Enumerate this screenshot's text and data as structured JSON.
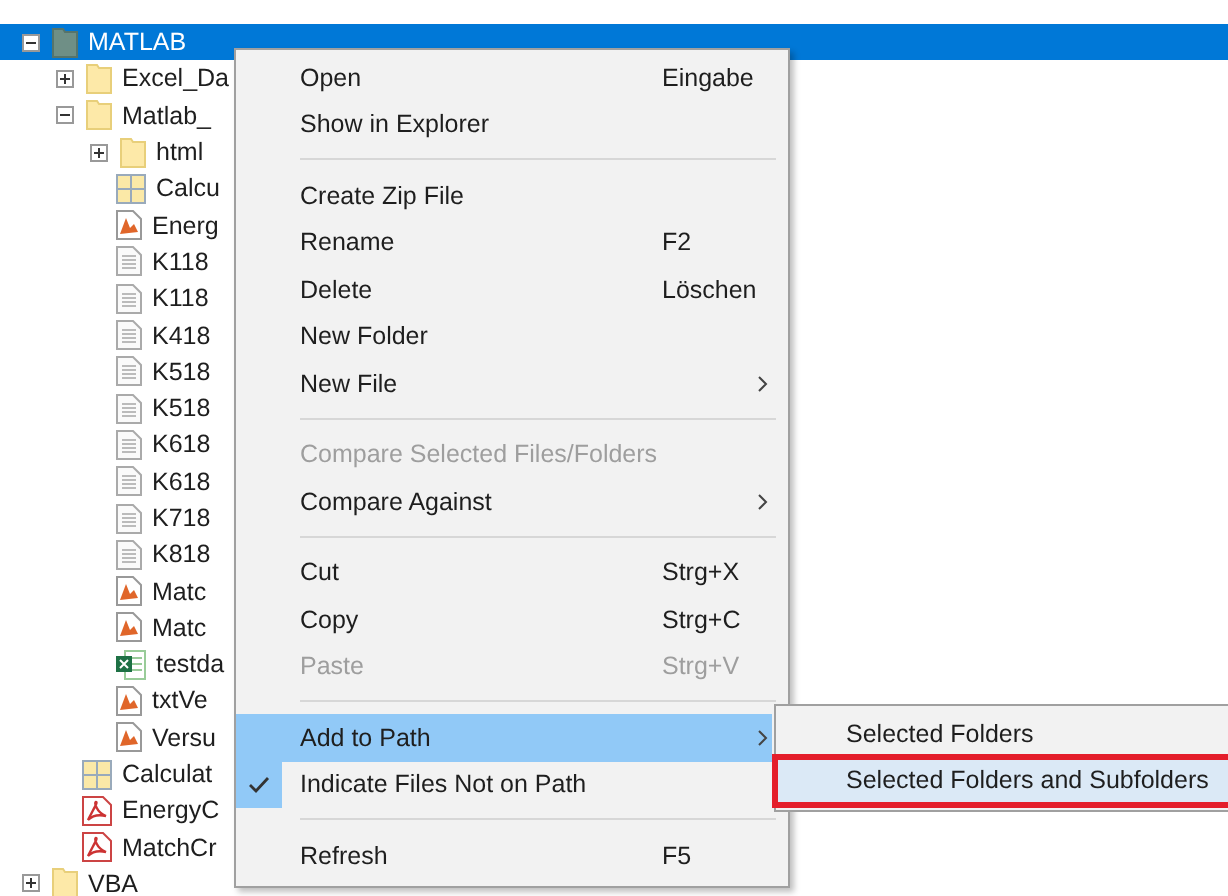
{
  "tree": [
    {
      "label": "MATLAB",
      "kind": "project",
      "expanded": true,
      "selected": true,
      "children": [
        {
          "label": "Excel_Da",
          "kind": "folder",
          "expanded": false,
          "selected": false
        },
        {
          "label": "Matlab_",
          "kind": "folder",
          "expanded": true,
          "selected": false,
          "children": [
            {
              "label": "html",
              "kind": "folder",
              "expanded": false,
              "selected": false
            },
            {
              "label": "Calcu",
              "kind": "app",
              "selected": false
            },
            {
              "label": "Energ",
              "kind": "script",
              "selected": false
            },
            {
              "label": "K118",
              "kind": "text",
              "selected": false
            },
            {
              "label": "K118",
              "kind": "text",
              "selected": false
            },
            {
              "label": "K418",
              "kind": "text",
              "selected": false
            },
            {
              "label": "K518",
              "kind": "text",
              "selected": false
            },
            {
              "label": "K518",
              "kind": "text",
              "selected": false
            },
            {
              "label": "K618",
              "kind": "text",
              "selected": false
            },
            {
              "label": "K618",
              "kind": "text",
              "selected": false
            },
            {
              "label": "K718",
              "kind": "text",
              "selected": false
            },
            {
              "label": "K818",
              "kind": "text",
              "selected": false
            },
            {
              "label": "Matc",
              "kind": "script",
              "selected": false
            },
            {
              "label": "Matc",
              "kind": "script",
              "selected": false
            },
            {
              "label": "testda",
              "kind": "excel",
              "selected": false
            },
            {
              "label": "txtVe",
              "kind": "script",
              "selected": false
            },
            {
              "label": "Versu",
              "kind": "script",
              "selected": false
            }
          ]
        },
        {
          "label": "Calculat",
          "kind": "app",
          "selected": false
        },
        {
          "label": "EnergyC",
          "kind": "pdf",
          "selected": false
        },
        {
          "label": "MatchCr",
          "kind": "pdf",
          "selected": false
        }
      ]
    },
    {
      "label": "VBA",
      "kind": "folder",
      "expanded": false,
      "selected": false
    }
  ],
  "context_menu": [
    {
      "kind": "item",
      "label": "Open",
      "shortcut": "Eingabe",
      "disabled": false,
      "checked": false,
      "selected": false,
      "submenu": false
    },
    {
      "kind": "item",
      "label": "Show in Explorer",
      "disabled": false,
      "checked": false,
      "selected": false,
      "submenu": false
    },
    {
      "kind": "separator"
    },
    {
      "kind": "item",
      "label": "Create Zip File",
      "disabled": false,
      "checked": false,
      "selected": false,
      "submenu": false
    },
    {
      "kind": "item",
      "label": "Rename",
      "shortcut": "F2",
      "disabled": false,
      "checked": false,
      "selected": false,
      "submenu": false
    },
    {
      "kind": "item",
      "label": "Delete",
      "shortcut": "Löschen",
      "disabled": false,
      "checked": false,
      "selected": false,
      "submenu": false
    },
    {
      "kind": "item",
      "label": "New Folder",
      "disabled": false,
      "checked": false,
      "selected": false,
      "submenu": false
    },
    {
      "kind": "item",
      "label": "New File",
      "disabled": false,
      "checked": false,
      "selected": false,
      "submenu": true
    },
    {
      "kind": "separator"
    },
    {
      "kind": "item",
      "label": "Compare Selected Files/Folders",
      "disabled": true,
      "checked": false,
      "selected": false,
      "submenu": false
    },
    {
      "kind": "item",
      "label": "Compare Against",
      "disabled": false,
      "checked": false,
      "selected": false,
      "submenu": true
    },
    {
      "kind": "separator"
    },
    {
      "kind": "item",
      "label": "Cut",
      "shortcut": "Strg+X",
      "disabled": false,
      "checked": false,
      "selected": false,
      "submenu": false
    },
    {
      "kind": "item",
      "label": "Copy",
      "shortcut": "Strg+C",
      "disabled": false,
      "checked": false,
      "selected": false,
      "submenu": false
    },
    {
      "kind": "item",
      "label": "Paste",
      "shortcut": "Strg+V",
      "disabled": true,
      "checked": false,
      "selected": false,
      "submenu": false
    },
    {
      "kind": "separator"
    },
    {
      "kind": "item",
      "label": "Add to Path",
      "disabled": false,
      "checked": false,
      "selected": true,
      "submenu": true
    },
    {
      "kind": "item",
      "label": "Indicate Files Not on Path",
      "disabled": false,
      "checked": true,
      "selected": false,
      "submenu": false
    },
    {
      "kind": "separator"
    },
    {
      "kind": "item",
      "label": "Refresh",
      "shortcut": "F5",
      "disabled": false,
      "checked": false,
      "selected": false,
      "submenu": false
    }
  ],
  "submenu": [
    {
      "label": "Selected Folders",
      "selected": false,
      "highlighted": false
    },
    {
      "label": "Selected Folders and Subfolders",
      "selected": true,
      "highlighted": true
    }
  ]
}
